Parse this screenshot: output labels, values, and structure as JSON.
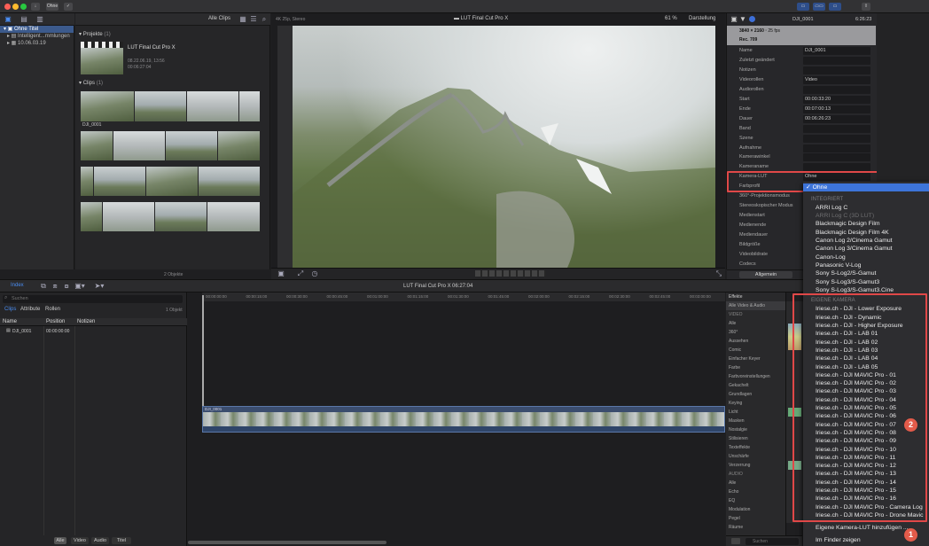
{
  "titlebar": {
    "btn1": "Ohne",
    "right_buttons": [
      "▭",
      "▭▭",
      "▭"
    ]
  },
  "library": {
    "items": [
      "Ohne Titel",
      "Intelligent...mmlungen",
      "10.06.03.19"
    ]
  },
  "browser": {
    "filter": "Alle Clips",
    "projects_header": "Projekte",
    "projects_count": "(1)",
    "project": {
      "name": "LUT Final Cut Pro X",
      "date": "08.22.06.19, 13:56",
      "duration": "00:06:27:04"
    },
    "clips_header": "Clips",
    "clips_count": "(1)",
    "clip_name": "DJI_0001",
    "footer": "2 Objekte"
  },
  "viewer": {
    "format": "4K 25p, Stereo",
    "title": "LUT Final Cut Pro X",
    "zoom": "61 %",
    "display": "Darstellung",
    "timecode": "00:00:00:00"
  },
  "inspector": {
    "name_top": "DJI_0001",
    "time_top": "6:26:23",
    "res": "3840 × 2160",
    "fps": "25 fps",
    "codec": "Rec. 709",
    "rows": [
      {
        "l": "Name",
        "v": "DJI_0001"
      },
      {
        "l": "Zuletzt geändert",
        "v": ""
      },
      {
        "l": "Notizen",
        "v": ""
      },
      {
        "l": "Videorollen",
        "v": "Video"
      },
      {
        "l": "Audiorollen",
        "v": ""
      },
      {
        "l": "Start",
        "v": "00:00:33:20"
      },
      {
        "l": "Ende",
        "v": "00:07:00:13"
      },
      {
        "l": "Dauer",
        "v": "00:06:26:23"
      },
      {
        "l": "Band",
        "v": ""
      },
      {
        "l": "Szene",
        "v": ""
      },
      {
        "l": "Aufnahme",
        "v": ""
      },
      {
        "l": "Kamerawinkel",
        "v": ""
      },
      {
        "l": "Kameraname",
        "v": ""
      },
      {
        "l": "Kamera-LUT",
        "v": "Ohne"
      },
      {
        "l": "Farbprofil",
        "v": ""
      },
      {
        "l": "360°-Projektionsmodus",
        "v": ""
      },
      {
        "l": "Stereoskopischer Modus",
        "v": ""
      },
      {
        "l": "Medienstart",
        "v": ""
      },
      {
        "l": "Medienende",
        "v": ""
      },
      {
        "l": "Mediendauer",
        "v": ""
      },
      {
        "l": "Bildgröße",
        "v": ""
      },
      {
        "l": "Videobildrate",
        "v": ""
      },
      {
        "l": "Codecs",
        "v": ""
      }
    ],
    "footer_select": "Allgemein"
  },
  "timeline": {
    "project": "LUT Final Cut Pro X",
    "duration": "06:27:04",
    "clip": "DJI_0001",
    "ticks": [
      "00:00:00:00",
      "00:00:15:00",
      "00:00:30:00",
      "00:00:45:00",
      "00:01:00:00",
      "00:01:15:00",
      "00:01:30:00",
      "00:01:45:00",
      "00:02:00:00",
      "00:02:15:00",
      "00:02:30:00",
      "00:02:45:00",
      "00:03:00:00"
    ]
  },
  "index": {
    "tab": "Index",
    "search_placeholder": "Suchen",
    "subtabs": [
      "Clips",
      "Attribute",
      "Rollen"
    ],
    "count": "1 Objekt",
    "columns": [
      "Name",
      "Position",
      "Notizen"
    ],
    "row": {
      "name": "DJI_0001",
      "position": "00:00:00:00"
    },
    "bottom_tabs": [
      "Alle",
      "Video",
      "Audio",
      "Titel"
    ]
  },
  "effects": {
    "header": "Effekte",
    "items": [
      "Alle Video & Audio",
      "VIDEO",
      "Alle",
      "360°",
      "Aussehen",
      "Comic",
      "Einfacher Keyer",
      "Farbe",
      "Farbvoreinstellungen",
      "Gekachelt",
      "Grundlagen",
      "Keying",
      "Licht",
      "Masken",
      "Nostalgie",
      "Stilisieren",
      "Texteffekte",
      "Unschärfe",
      "Verzerrung",
      "AUDIO",
      "Alle",
      "Echo",
      "EQ",
      "Modulation",
      "Pegel",
      "Räume"
    ],
    "search_placeholder": "Suchen"
  },
  "dropdown": {
    "selected": "Ohne",
    "integriert_header": "INTEGRIERT",
    "integriert": [
      "ARRI Log C",
      "ARRI Log C (3D LUT)",
      "Blackmagic Design Film",
      "Blackmagic Design Film 4K",
      "Canon Log 2/Cinema Gamut",
      "Canon Log 3/Cinema Gamut",
      "Canon-Log",
      "Panasonic V-Log",
      "Sony S-Log2/S-Gamut",
      "Sony S-Log3/S-Gamut3",
      "Sony S-Log3/S-Gamut3.Cine"
    ],
    "eigene_header": "EIGENE KAMERA",
    "eigene": [
      "Iriese.ch - DJI - Lower Exposure",
      "Iriese.ch - DJI - Dynamic",
      "Iriese.ch - DJI - Higher Exposure",
      "Iriese.ch - DJI - LAB 01",
      "Iriese.ch - DJI - LAB 02",
      "Iriese.ch - DJI - LAB 03",
      "Iriese.ch - DJI - LAB 04",
      "Iriese.ch - DJI - LAB 05",
      "Iriese.ch - DJI MAVIC Pro - 01",
      "Iriese.ch - DJI MAVIC Pro - 02",
      "Iriese.ch - DJI MAVIC Pro - 03",
      "Iriese.ch - DJI MAVIC Pro - 04",
      "Iriese.ch - DJI MAVIC Pro - 05",
      "Iriese.ch - DJI MAVIC Pro - 06",
      "Iriese.ch - DJI MAVIC Pro - 07",
      "Iriese.ch - DJI MAVIC Pro - 08",
      "Iriese.ch - DJI MAVIC Pro - 09",
      "Iriese.ch - DJI MAVIC Pro - 10",
      "Iriese.ch - DJI MAVIC Pro - 11",
      "Iriese.ch - DJI MAVIC Pro - 12",
      "Iriese.ch - DJI MAVIC Pro - 13",
      "Iriese.ch - DJI MAVIC Pro - 14",
      "Iriese.ch - DJI MAVIC Pro - 15",
      "Iriese.ch - DJI MAVIC Pro - 16",
      "Iriese.ch - DJI MAVIC Pro - Camera Log",
      "Iriese.ch - DJI MAVIC Pro - Drone Mavic"
    ],
    "add_lut": "Eigene Kamera-LUT hinzufügen ...",
    "show_finder": "Im Finder zeigen"
  },
  "badges": {
    "b1": "1",
    "b2": "2"
  }
}
